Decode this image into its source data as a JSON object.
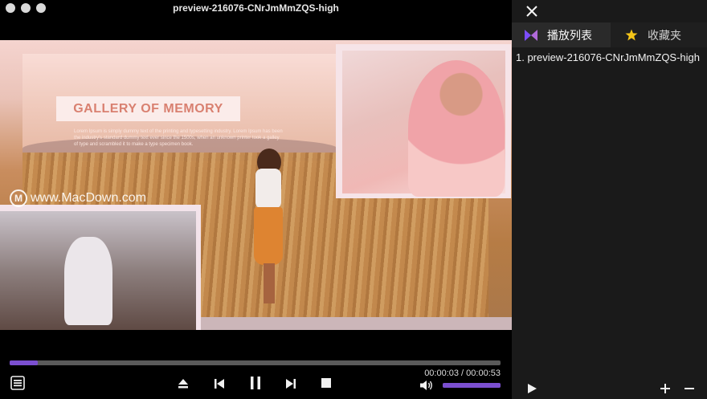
{
  "window": {
    "title": "preview-216076-CNrJmMmZQS-high"
  },
  "video": {
    "banner_title": "GALLERY OF MEMORY",
    "lorem_text": "Lorem Ipsum is simply dummy text of the printing and typesetting industry. Lorem Ipsum has been the industry's standard dummy text ever since the 1500s, when an unknown printer took a galley of type and scrambled it to make a type specimen book.",
    "watermark": "www.MacDown.com"
  },
  "controls": {
    "progress_fraction": 0.057,
    "time_display": "00:00:03 / 00:00:53",
    "volume_fraction": 1.0,
    "accent_color": "#7b4fd0",
    "icons": [
      "playlist-icon",
      "eject-icon",
      "previous-icon",
      "pause-icon",
      "next-icon",
      "stop-icon",
      "volume-icon"
    ]
  },
  "sidebar": {
    "tabs": [
      {
        "label": "播放列表",
        "icon": "bowtie-logo-icon",
        "active": true
      },
      {
        "label": "收藏夹",
        "icon": "star-icon",
        "active": false
      }
    ],
    "playlist": [
      {
        "label": "1. preview-216076-CNrJmMmZQS-high"
      }
    ],
    "footer_icons": [
      "play-icon",
      "add-icon",
      "remove-icon"
    ]
  }
}
